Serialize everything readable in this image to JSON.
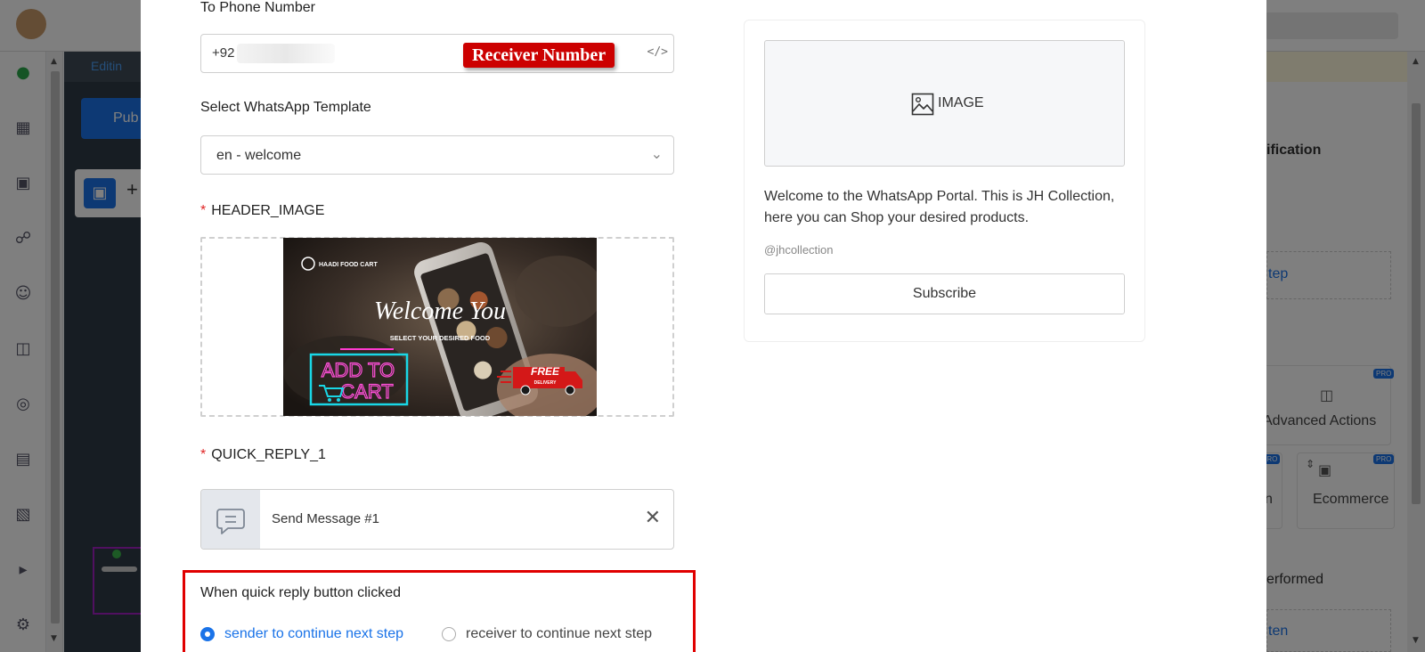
{
  "background": {
    "editing_label": "Editin",
    "publish_label": "Pub",
    "right_panel": {
      "notification_fragment": "ification",
      "step_link_fragment": "tep",
      "advanced_actions_label": "Advanced Actions",
      "ecommerce_label": "Ecommerce",
      "left_card_fragment": "n",
      "performed_fragment": "erformed",
      "bottom_link_fragment": "ten",
      "pro_badge": "PRO"
    },
    "sidebar_icons": [
      "chat-icon",
      "dashboard-icon",
      "presentation-icon",
      "headset-icon",
      "user-icon",
      "book-icon",
      "target-icon",
      "list-icon",
      "archive-icon",
      "megaphone-icon",
      "gear-icon"
    ]
  },
  "form": {
    "phone": {
      "label": "To Phone Number",
      "value": "+92",
      "tag": "Receiver Number",
      "code_icon": "</>"
    },
    "template": {
      "label": "Select WhatsApp Template",
      "value": "en - welcome"
    },
    "header_image": {
      "label": "HEADER_IMAGE",
      "required": "*",
      "image_texts": {
        "brand": "HAADI FOOD CART",
        "welcome": "Welcome You",
        "tagline": "SELECT YOUR DESIRED FOOD",
        "add_to": "ADD TO",
        "cart": "CART",
        "free": "FREE",
        "delivery": "DELIVERY"
      }
    },
    "quick_reply": {
      "label": "QUICK_REPLY_1",
      "required": "*",
      "value": "Send Message #1"
    },
    "quick_reply_action": {
      "label": "When quick reply button clicked",
      "options": [
        {
          "label": "sender to continue next step",
          "selected": true
        },
        {
          "label": "receiver to continue next step",
          "selected": false
        }
      ]
    }
  },
  "preview": {
    "image_placeholder": "IMAGE",
    "body": "Welcome to the WhatsApp Portal. This is JH Collection, here you can Shop your desired products.",
    "handle": "@jhcollection",
    "button_label": "Subscribe"
  },
  "colors": {
    "accent": "#1a73e8",
    "highlight_red": "#e00000",
    "required_red": "#e02424"
  }
}
